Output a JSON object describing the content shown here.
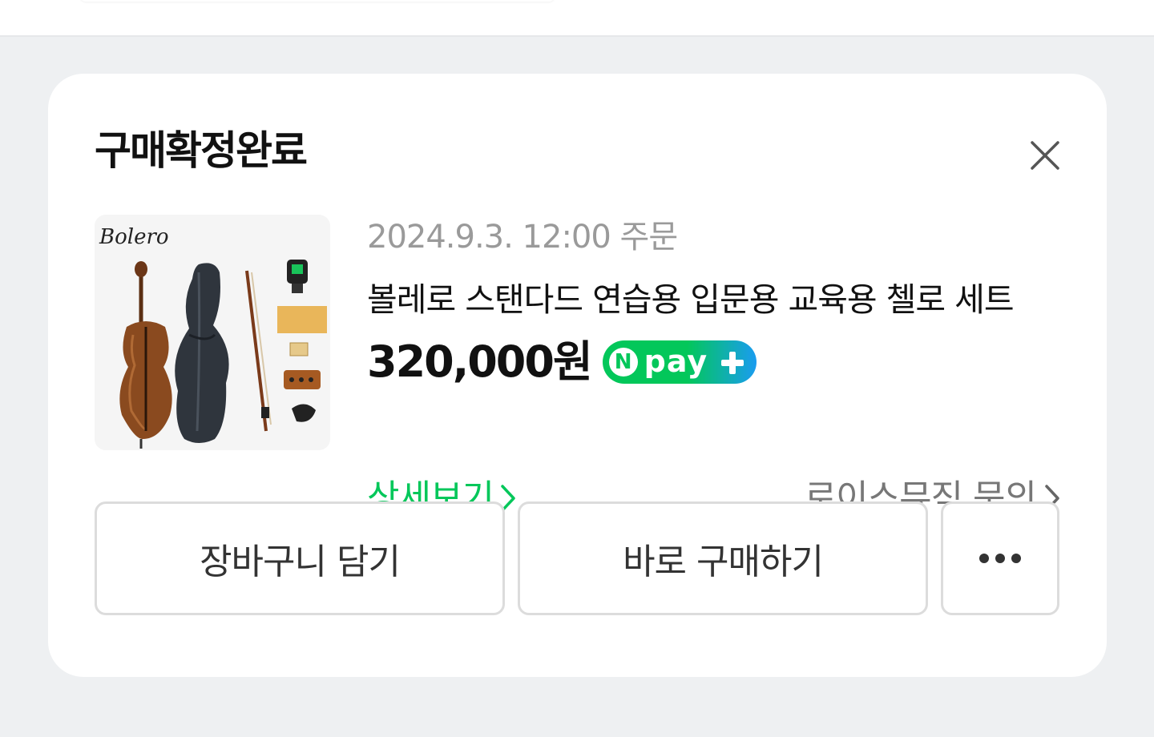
{
  "card": {
    "title": "구매확정완료",
    "order_date": "2024.9.3. 12:00 주문",
    "product_name": "볼레로 스탠다드 연습용 입문용 교육용 첼로 세트",
    "price": "320,000원",
    "badge": {
      "n_letter": "N",
      "text": "pay"
    },
    "detail_link": "상세보기",
    "seller_link": "로이스뮤직 문의",
    "thumbnail": {
      "brand": "Bolero"
    }
  },
  "actions": {
    "cart_label": "장바구니 담기",
    "buy_label": "바로 구매하기"
  },
  "icons": {
    "close": "close-icon",
    "chevron": "chevron-right-icon",
    "more": "more-dots-icon",
    "plus": "plus-icon"
  },
  "colors": {
    "accent_green": "#03c75a",
    "npay_blue": "#1a9cf0",
    "muted_text": "#9a9a9a"
  }
}
